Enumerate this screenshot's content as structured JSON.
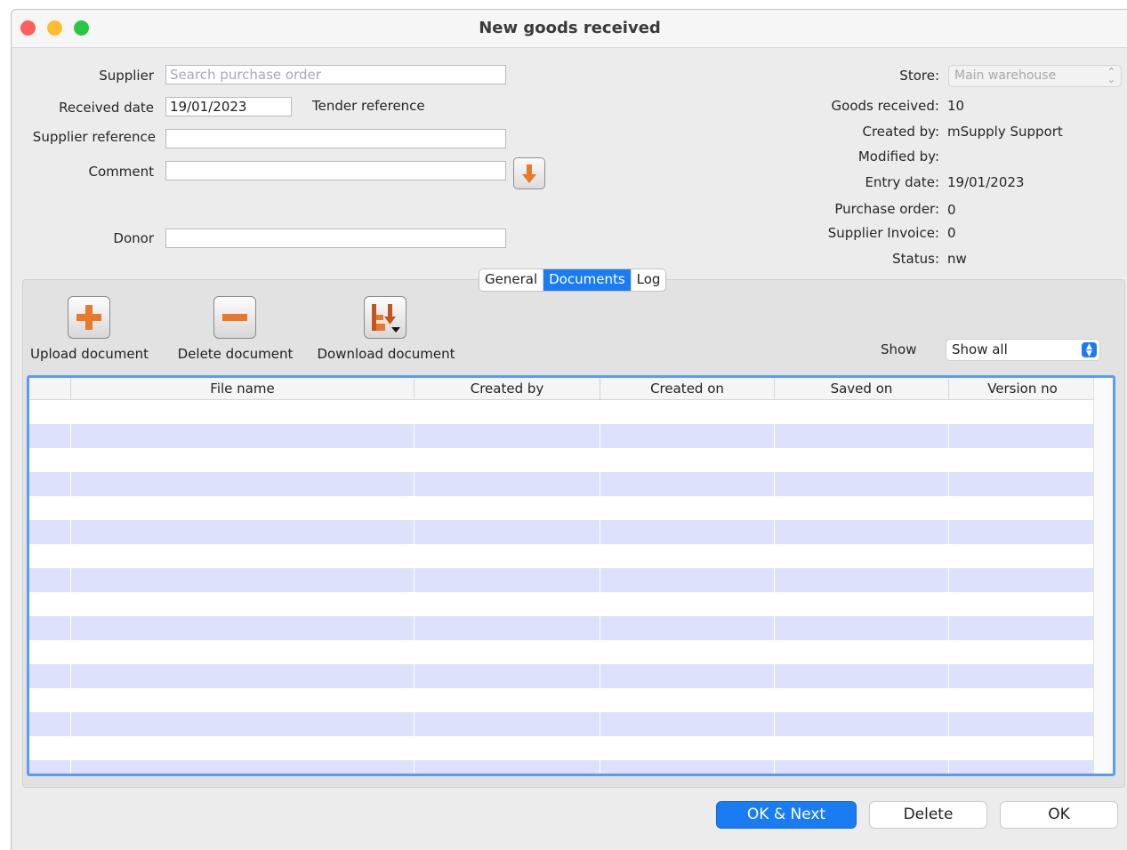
{
  "window": {
    "title": "New goods received",
    "traffic_colors": {
      "close": "#ff5f57",
      "minimize": "#febc2e",
      "zoom": "#28c840"
    }
  },
  "form": {
    "supplier_label": "Supplier",
    "supplier_placeholder": "Search purchase order",
    "received_date_label": "Received date",
    "received_date_value": "19/01/2023",
    "tender_reference_label": "Tender reference",
    "supplier_reference_label": "Supplier reference",
    "supplier_reference_value": "",
    "comment_label": "Comment",
    "comment_value": "",
    "donor_label": "Donor",
    "donor_value": ""
  },
  "info": {
    "store_label": "Store:",
    "store_value": "Main warehouse",
    "goods_received_label": "Goods received:",
    "goods_received_value": "10",
    "created_by_label": "Created by:",
    "created_by_value": "mSupply Support",
    "modified_by_label": "Modified by:",
    "modified_by_value": "",
    "entry_date_label": "Entry date:",
    "entry_date_value": "19/01/2023",
    "purchase_order_label": "Purchase order:",
    "purchase_order_value": "0",
    "supplier_invoice_label": "Supplier Invoice:",
    "supplier_invoice_value": "0",
    "status_label": "Status:",
    "status_value": "nw"
  },
  "tabs": [
    {
      "label": "General",
      "active": false
    },
    {
      "label": "Documents",
      "active": true
    },
    {
      "label": "Log",
      "active": false
    }
  ],
  "toolbar": {
    "upload_label": "Upload document",
    "delete_label": "Delete document",
    "download_label": "Download document",
    "show_label": "Show",
    "show_value": "Show all"
  },
  "table": {
    "columns": [
      "",
      "File name",
      "Created by",
      "Created on",
      "Saved on",
      "Version no"
    ],
    "rows": []
  },
  "buttons": {
    "ok_next": "OK & Next",
    "delete": "Delete",
    "ok": "OK"
  },
  "colors": {
    "accent": "#1a7cf2",
    "row_alt": "#dde1fb",
    "icon_orange": "#e8792a"
  }
}
